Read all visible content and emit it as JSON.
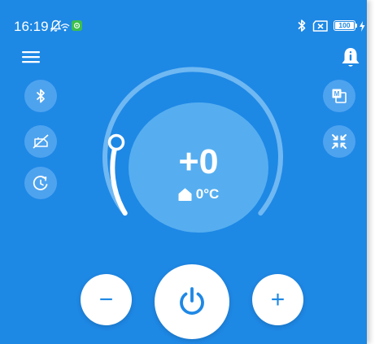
{
  "status_bar": {
    "time": "16:19",
    "battery_level": "100",
    "icons": [
      "muted-bell-icon",
      "wifi-icon",
      "app-notification-icon",
      "bluetooth-icon",
      "no-sim-icon",
      "battery-icon",
      "charging-icon"
    ]
  },
  "header": {
    "menu_icon": "hamburger-menu-icon",
    "notification_icon": "bell-alert-icon"
  },
  "left_buttons": [
    "bluetooth-icon",
    "no-schedule-icon",
    "timer-icon"
  ],
  "right_buttons": [
    "mode-m-icon",
    "fullscreen-exit-icon"
  ],
  "dial": {
    "setpoint": "+0",
    "room_temperature": "0°C",
    "room_icon": "home-icon",
    "knob_position": 0
  },
  "controls": {
    "decrease_label": "−",
    "increase_label": "+",
    "power_icon": "power-icon"
  },
  "colors": {
    "background": "#1e88e5",
    "button_fill": "#4ea3ef",
    "dial_center": "#56aef0",
    "accent_white": "#ffffff"
  }
}
